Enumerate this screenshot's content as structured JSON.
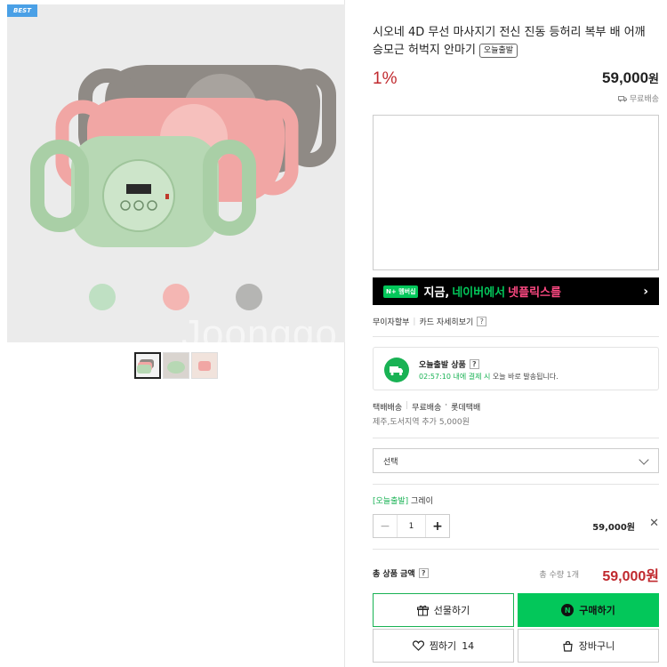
{
  "hero": {
    "badge": "BEST",
    "watermark": "Joonggo",
    "swatches": [
      "#bfe0c3",
      "#f4b6b3",
      "#b5b5b3"
    ]
  },
  "product": {
    "title": "시오네 4D 무선 마사지기 전신 진동 등허리 복부 배 어깨 승모근 허벅지 안마기",
    "tag": "오늘출발",
    "discount_rate": "1%",
    "price": "59,000",
    "price_unit": "원",
    "free_shipping": "무료배송"
  },
  "promo": {
    "badge_text": "N+ 멤버십",
    "text_1": "지금,",
    "text_2": "네이버에서",
    "text_3": "넷플릭스를"
  },
  "links": {
    "interest_free": "무이자할부",
    "card_benefits": "카드 자세히보기"
  },
  "today": {
    "title": "오늘출발 상품",
    "time": "02:57:10 내에 결제 시",
    "desc": " 오늘 바로 발송됩니다."
  },
  "delivery": {
    "type": "택배배송",
    "fee": "무료배송",
    "carrier": "롯데택배",
    "extra": "제주,도서지역 추가 5,000원"
  },
  "select": {
    "placeholder": "선택"
  },
  "option": {
    "tag": "[오늘출발]",
    "name": "그레이",
    "quantity": "1",
    "price": "59,000원"
  },
  "total": {
    "label": "총 상품 금액",
    "count": "총 수량 1개",
    "price": "59,000원"
  },
  "buttons": {
    "gift": "선물하기",
    "buy": "구매하기",
    "wish": "찜하기",
    "wish_count": "14",
    "cart": "장바구니"
  }
}
